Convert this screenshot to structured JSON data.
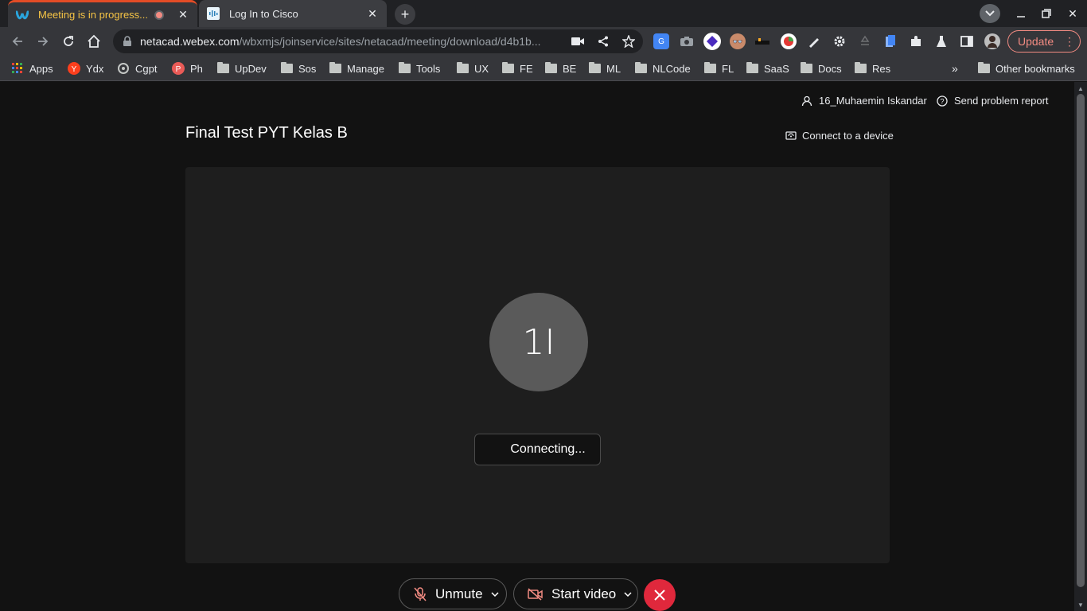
{
  "browser": {
    "tabs": [
      {
        "title": "Meeting is in progress...",
        "active": true
      },
      {
        "title": "Log In to Cisco",
        "active": false
      }
    ],
    "url_host": "netacad.webex.com",
    "url_path": "/wbxmjs/joinservice/sites/netacad/meeting/download/d4b1b...",
    "update_label": "Update",
    "bookmarks": [
      {
        "label": "Apps",
        "icon": "apps-grid-icon"
      },
      {
        "label": "Ydx",
        "icon": "yandex-icon"
      },
      {
        "label": "Cgpt",
        "icon": "chatgpt-icon"
      },
      {
        "label": "Ph",
        "icon": "ph-icon"
      },
      {
        "label": "UpDev",
        "icon": "folder-icon"
      },
      {
        "label": "Sos",
        "icon": "folder-icon"
      },
      {
        "label": "Manage",
        "icon": "folder-icon"
      },
      {
        "label": "Tools",
        "icon": "folder-icon"
      },
      {
        "label": "UX",
        "icon": "folder-icon"
      },
      {
        "label": "FE",
        "icon": "folder-icon"
      },
      {
        "label": "BE",
        "icon": "folder-icon"
      },
      {
        "label": "ML",
        "icon": "folder-icon"
      },
      {
        "label": "NLCode",
        "icon": "folder-icon"
      },
      {
        "label": "FL",
        "icon": "folder-icon"
      },
      {
        "label": "SaaS",
        "icon": "folder-icon"
      },
      {
        "label": "Docs",
        "icon": "folder-icon"
      },
      {
        "label": "Res",
        "icon": "folder-icon"
      }
    ],
    "other_bookmarks": "Other bookmarks"
  },
  "meeting": {
    "user_name": "16_Muhaemin Iskandar",
    "problem_report": "Send problem report",
    "title": "Final Test PYT Kelas B",
    "connect_device": "Connect to a device",
    "avatar_initials": "1I",
    "status": "Connecting...",
    "unmute_label": "Unmute",
    "start_video_label": "Start video"
  },
  "colors": {
    "leave_red": "#e0283c",
    "page_bg": "#121212",
    "stage_bg": "#1e1e1e",
    "avatar_bg": "#5a5a5a",
    "update_accent": "#f28b82"
  }
}
